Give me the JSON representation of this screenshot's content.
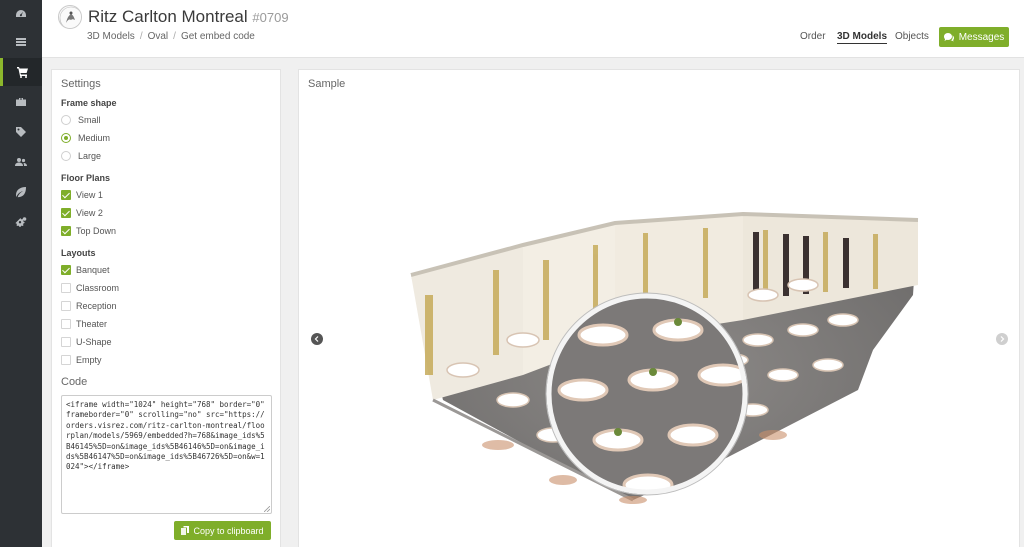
{
  "header": {
    "title": "Ritz Carlton Montreal",
    "number": "#0709",
    "breadcrumb": [
      "3D Models",
      "Oval",
      "Get embed code"
    ],
    "nav": [
      {
        "label": "Order",
        "active": false
      },
      {
        "label": "3D Models",
        "active": true
      },
      {
        "label": "Objects",
        "active": false
      }
    ],
    "messages_label": "Messages"
  },
  "sidebar": {
    "items": [
      {
        "icon": "dashboard-icon",
        "active": false
      },
      {
        "icon": "list-icon",
        "active": false
      },
      {
        "icon": "cart-icon",
        "active": true
      },
      {
        "icon": "briefcase-icon",
        "active": false
      },
      {
        "icon": "tags-icon",
        "active": false
      },
      {
        "icon": "users-icon",
        "active": false
      },
      {
        "icon": "leaf-icon",
        "active": false
      },
      {
        "icon": "cogs-icon",
        "active": false
      }
    ]
  },
  "settings": {
    "title": "Settings",
    "frame_shape": {
      "label": "Frame shape",
      "options": [
        {
          "label": "Small",
          "selected": false
        },
        {
          "label": "Medium",
          "selected": true
        },
        {
          "label": "Large",
          "selected": false
        }
      ]
    },
    "floor_plans": {
      "label": "Floor Plans",
      "options": [
        {
          "label": "View 1",
          "checked": true
        },
        {
          "label": "View 2",
          "checked": true
        },
        {
          "label": "Top Down",
          "checked": true
        }
      ]
    },
    "layouts": {
      "label": "Layouts",
      "options": [
        {
          "label": "Banquet",
          "checked": true
        },
        {
          "label": "Classroom",
          "checked": false
        },
        {
          "label": "Reception",
          "checked": false
        },
        {
          "label": "Theater",
          "checked": false
        },
        {
          "label": "U-Shape",
          "checked": false
        },
        {
          "label": "Empty",
          "checked": false
        }
      ]
    },
    "code_label": "Code",
    "code": "<iframe width=\"1024\" height=\"768\" border=\"0\" frameborder=\"0\" scrolling=\"no\" src=\"https://orders.visrez.com/ritz-carlton-montreal/floorplan/models/5969/embedded?h=768&image_ids%5B46145%5D=on&image_ids%5B46146%5D=on&image_ids%5B46147%5D=on&image_ids%5B46726%5D=on&w=1024\"></iframe>",
    "copy_label": "Copy to clipboard"
  },
  "sample": {
    "title": "Sample"
  },
  "colors": {
    "accent": "#7fae2a",
    "nav_bg": "#2d3135"
  }
}
